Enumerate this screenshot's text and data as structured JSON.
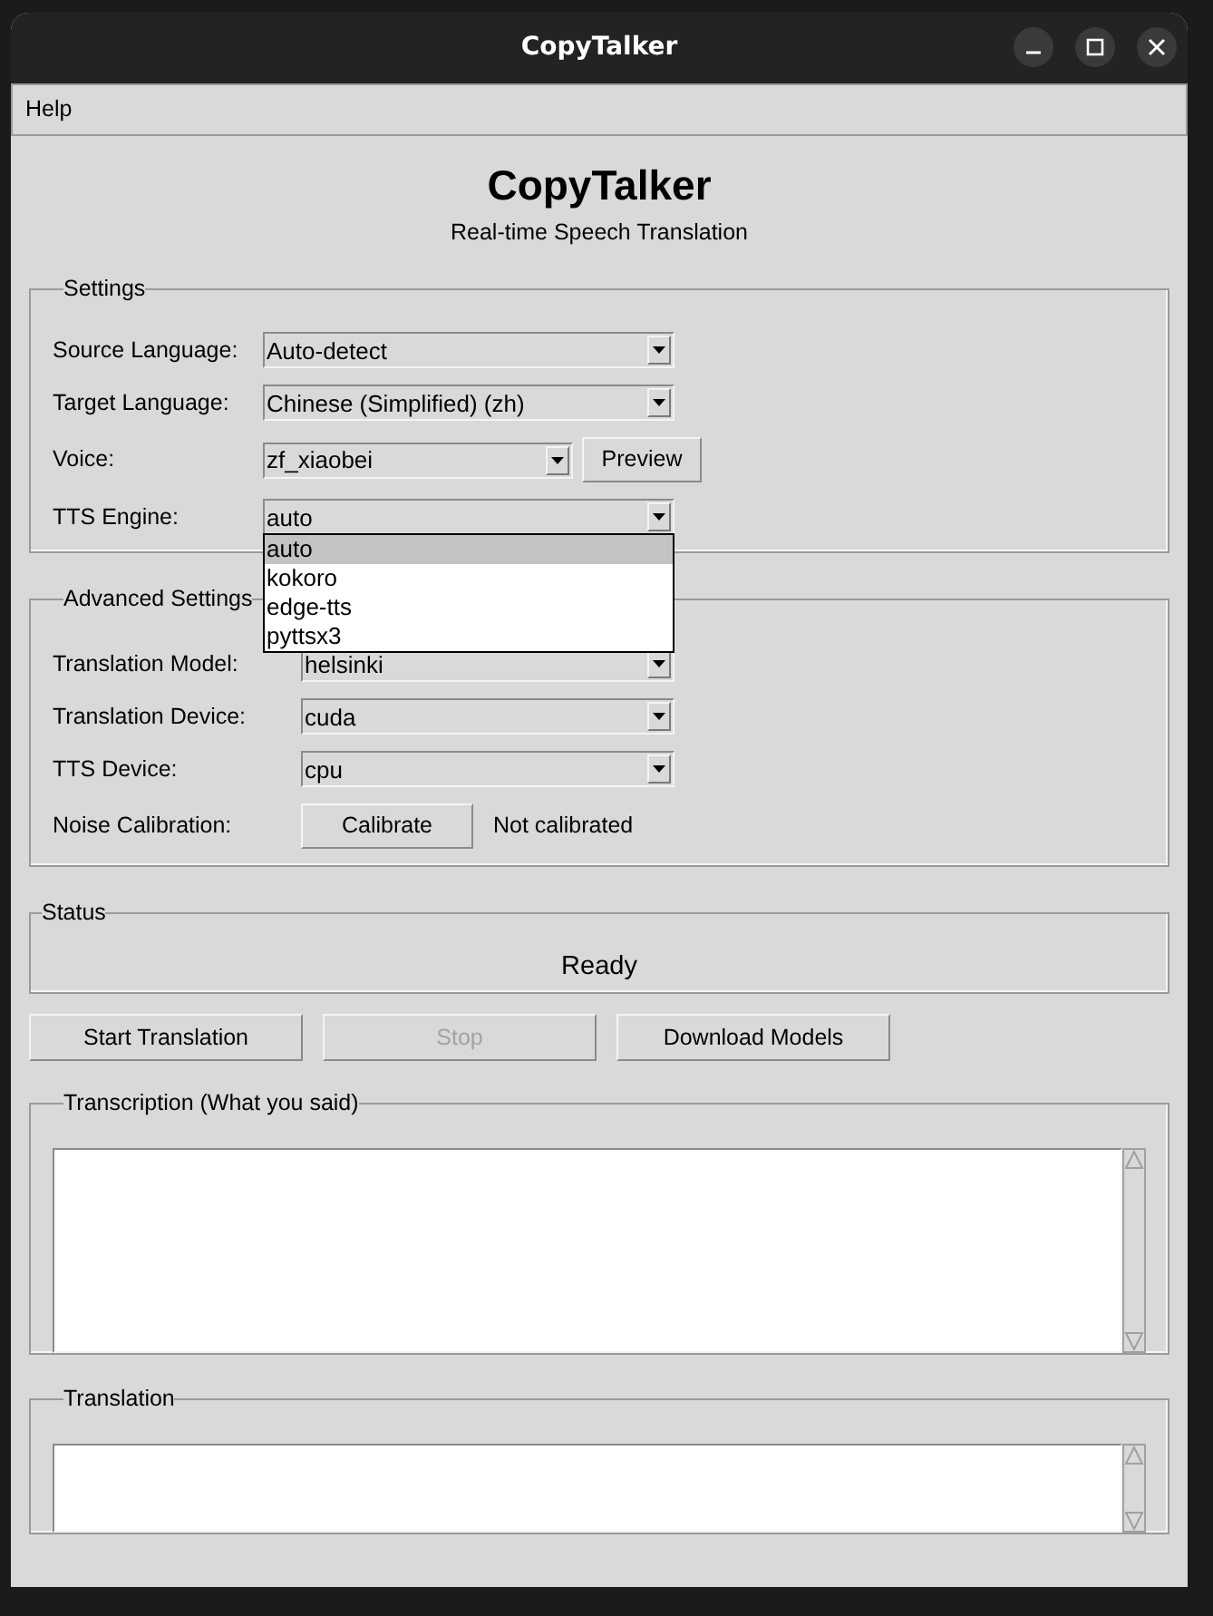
{
  "window": {
    "title": "CopyTalker"
  },
  "menu": [
    {
      "label": "Help"
    }
  ],
  "app_title": "CopyTalker",
  "subtitle": "Real-time Speech Translation",
  "settings": {
    "title": "Settings",
    "rows": [
      {
        "kind": "combo",
        "label": "Source Language:",
        "value": "Auto-detect"
      },
      {
        "kind": "combo",
        "label": "Target Language:",
        "value": "Chinese (Simplified) (zh)"
      },
      {
        "kind": "combo_button",
        "label": "Voice:",
        "value": "zf_xiaobei",
        "button": "Preview"
      },
      {
        "kind": "combo",
        "label": "TTS Engine:",
        "value": "auto",
        "expanded": true,
        "options": [
          {
            "label": "auto",
            "selected": true
          },
          {
            "label": "kokoro",
            "selected": false
          },
          {
            "label": "edge-tts",
            "selected": false
          },
          {
            "label": "pyttsx3",
            "selected": false
          }
        ]
      }
    ]
  },
  "advanced": {
    "title": "Advanced Settings",
    "rows": [
      {
        "kind": "combo",
        "label": "Translation Model:",
        "value": "helsinki"
      },
      {
        "kind": "combo",
        "label": "Translation Device:",
        "value": "cuda"
      },
      {
        "kind": "combo",
        "label": "TTS Device:",
        "value": "cpu"
      },
      {
        "kind": "button_text",
        "label": "Noise Calibration:",
        "button": "Calibrate",
        "text": "Not calibrated"
      }
    ]
  },
  "status": {
    "title": "Status",
    "text": "Ready"
  },
  "buttons": [
    {
      "label": "Start Translation",
      "disabled": false
    },
    {
      "label": "Stop",
      "disabled": true
    },
    {
      "label": "Download Models",
      "disabled": false
    }
  ],
  "transcription": {
    "title": "Transcription (What you said)"
  },
  "translation": {
    "title": "Translation"
  }
}
